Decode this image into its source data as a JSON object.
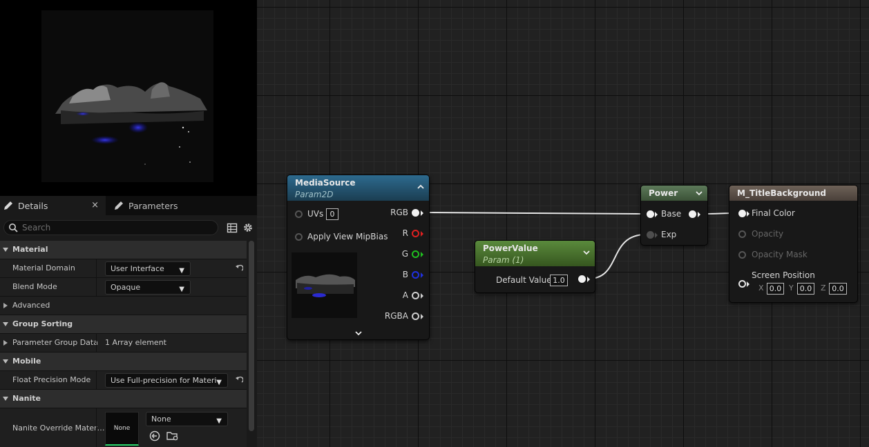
{
  "tabs": {
    "details": "Details",
    "parameters": "Parameters",
    "close": "×"
  },
  "search": {
    "placeholder": "Search"
  },
  "properties": {
    "material_cat": "Material",
    "material_domain": {
      "label": "Material Domain",
      "value": "User Interface"
    },
    "blend_mode": {
      "label": "Blend Mode",
      "value": "Opaque"
    },
    "advanced": "Advanced",
    "group_sorting_cat": "Group Sorting",
    "param_group_data": {
      "label": "Parameter Group Data",
      "value": "1 Array element"
    },
    "mobile_cat": "Mobile",
    "float_precision": {
      "label": "Float Precision Mode",
      "value": "Use Full-precision for Materi"
    },
    "nanite_cat": "Nanite",
    "nanite_override": {
      "label": "Nanite Override Mater…",
      "thumb": "None",
      "value": "None"
    }
  },
  "nodes": {
    "media": {
      "title": "MediaSource",
      "subtitle": "Param2D",
      "uvs_label": "UVs",
      "uvs_value": "0",
      "mipbias": "Apply View MipBias",
      "outputs": [
        "RGB",
        "R",
        "G",
        "B",
        "A",
        "RGBA"
      ],
      "colors": {
        "R": "#e02020",
        "G": "#20c020",
        "B": "#2030e0"
      }
    },
    "power_value": {
      "title": "PowerValue",
      "subtitle": "Param (1)",
      "default_label": "Default Value",
      "default_value": "1.0"
    },
    "power": {
      "title": "Power",
      "base": "Base",
      "exp": "Exp"
    },
    "output": {
      "title": "M_TitleBackground",
      "final_color": "Final Color",
      "opacity": "Opacity",
      "opacity_mask": "Opacity Mask",
      "screen_position": "Screen Position",
      "x_label": "X",
      "x": "0.0",
      "y_label": "Y",
      "y": "0.0",
      "z_label": "Z",
      "z": "0.0"
    }
  }
}
